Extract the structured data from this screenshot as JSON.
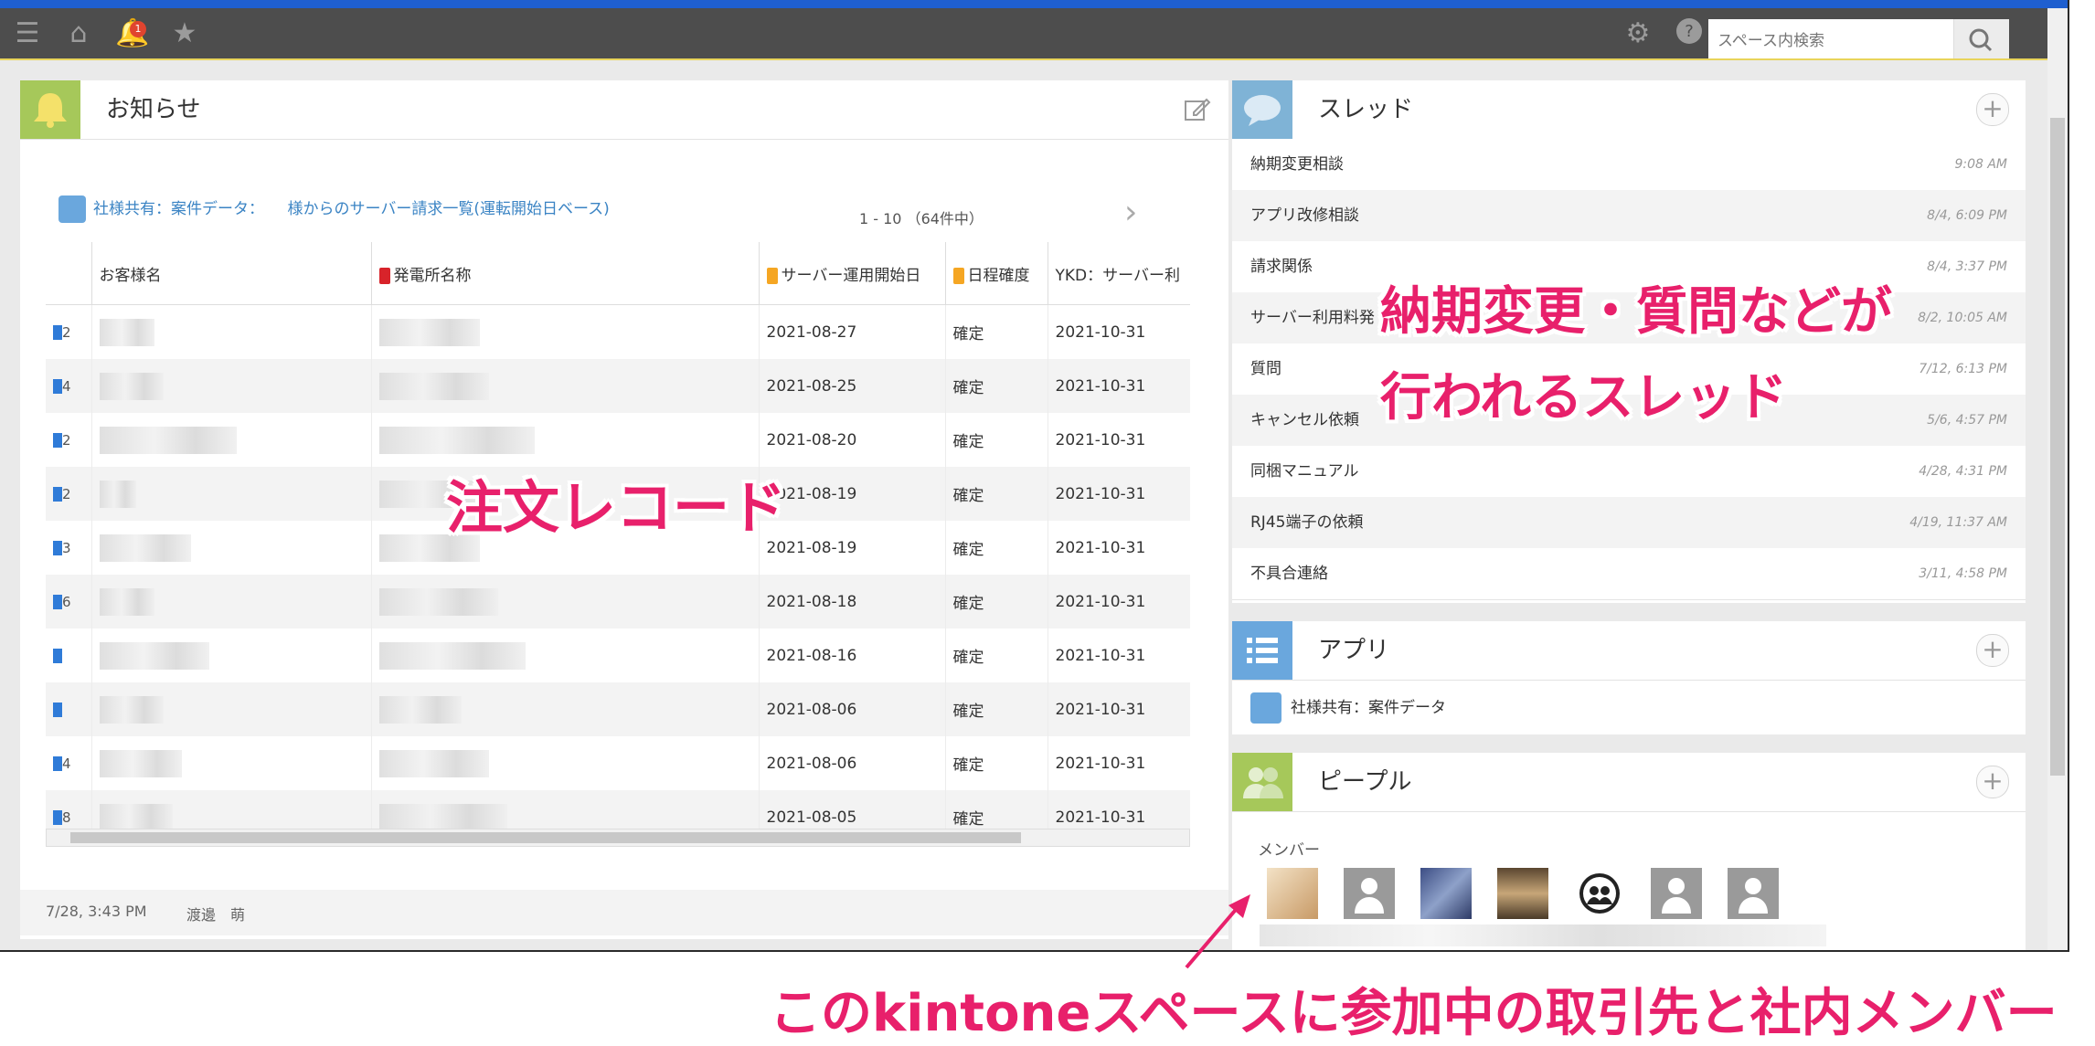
{
  "header": {
    "search_placeholder": "スペース内検索",
    "notification_count": "1"
  },
  "notice": {
    "title": "お知らせ",
    "list_link": "社様共有：案件データ：　　様からのサーバー請求一覧(運転開始日ベース)",
    "pager": "1 - 10 （64件中）",
    "columns": [
      "お客様名",
      "発電所名称",
      "サーバー運用開始日",
      "日程確度",
      "YKD：サーバー利"
    ],
    "rows": [
      {
        "num": "2",
        "date": "2021-08-27",
        "status": "確定",
        "end": "2021-10-31"
      },
      {
        "num": "4",
        "date": "2021-08-25",
        "status": "確定",
        "end": "2021-10-31"
      },
      {
        "num": "2",
        "date": "2021-08-20",
        "status": "確定",
        "end": "2021-10-31"
      },
      {
        "num": "2",
        "date": "2021-08-19",
        "status": "確定",
        "end": "2021-10-31"
      },
      {
        "num": "3",
        "date": "2021-08-19",
        "status": "確定",
        "end": "2021-10-31"
      },
      {
        "num": "6",
        "date": "2021-08-18",
        "status": "確定",
        "end": "2021-10-31"
      },
      {
        "num": "",
        "date": "2021-08-16",
        "status": "確定",
        "end": "2021-10-31"
      },
      {
        "num": "",
        "date": "2021-08-06",
        "status": "確定",
        "end": "2021-10-31"
      },
      {
        "num": "4",
        "date": "2021-08-06",
        "status": "確定",
        "end": "2021-10-31"
      },
      {
        "num": "8",
        "date": "2021-08-05",
        "status": "確定",
        "end": "2021-10-31"
      }
    ],
    "footer_time": "7/28, 3:43 PM",
    "footer_user": "渡邊　萌"
  },
  "threads": {
    "title": "スレッド",
    "items": [
      {
        "name": "納期変更相談",
        "time": "9:08 AM"
      },
      {
        "name": "アプリ改修相談",
        "time": "8/4, 6:09 PM"
      },
      {
        "name": "請求関係",
        "time": "8/4, 3:37 PM"
      },
      {
        "name": "サーバー利用料発",
        "time": "8/2, 10:05 AM"
      },
      {
        "name": "質問",
        "time": "7/12, 6:13 PM"
      },
      {
        "name": "キャンセル依頼",
        "time": "5/6, 4:57 PM"
      },
      {
        "name": "同梱マニュアル",
        "time": "4/28, 4:31 PM"
      },
      {
        "name": "RJ45端子の依頼",
        "time": "4/19, 11:37 AM"
      },
      {
        "name": "不具合連絡",
        "time": "3/11, 4:58 PM"
      }
    ]
  },
  "apps": {
    "title": "アプリ",
    "item": "社様共有：案件データ"
  },
  "people": {
    "title": "ピープル",
    "members_label": "メンバー"
  },
  "annotations": {
    "orders": "注文レコード",
    "threads_line1": "納期変更・質問などが",
    "threads_line2": "行われるスレッド",
    "members": "このkintoneスペースに参加中の取引先と社内メンバー"
  },
  "colors": {
    "accent_pink": "#e8206b",
    "header_bg": "#4d4d4d",
    "notice_icon": "#a6c85a",
    "thread_icon": "#7fb3d6",
    "app_icon": "#6aa7dd",
    "people_icon": "#a6c85a"
  }
}
